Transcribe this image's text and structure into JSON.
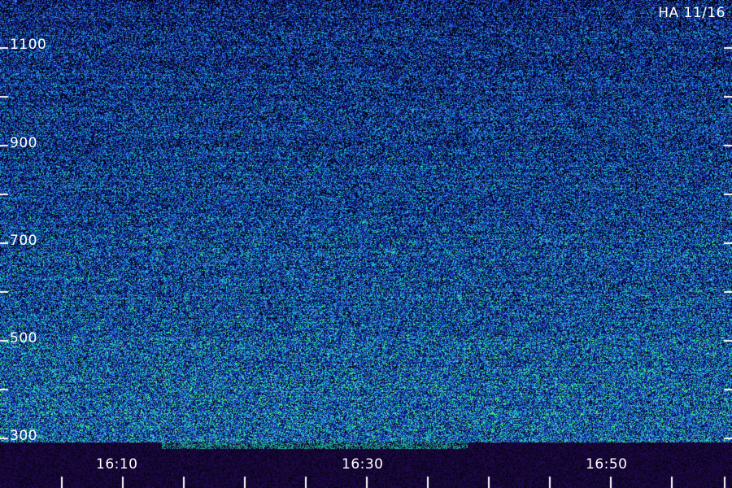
{
  "header": {
    "station_label": "HA 11/16"
  },
  "y_axis": {
    "tick_labels": [
      "1100",
      "900",
      "700",
      "500",
      "300"
    ]
  },
  "x_axis": {
    "tick_labels": [
      "16:10",
      "16:30",
      "16:50"
    ]
  },
  "colors": {
    "background": "#000000",
    "low": "#10106a",
    "mid": "#1e5cc8",
    "high": "#18c8c0",
    "peak": "#4cff70",
    "axis": "#ffffff"
  }
}
